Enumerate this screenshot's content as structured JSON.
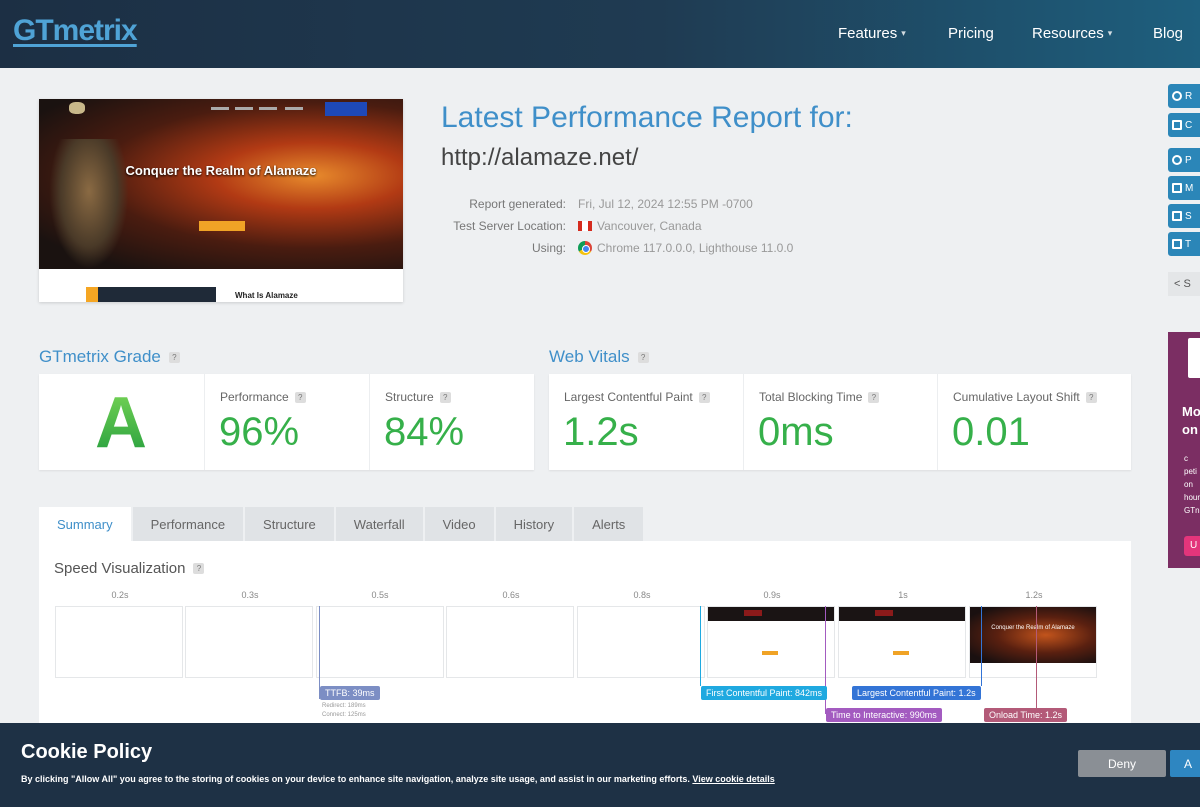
{
  "header": {
    "logo": "GTmetrix",
    "nav": [
      {
        "label": "Features",
        "dropdown": true
      },
      {
        "label": "Pricing",
        "dropdown": false
      },
      {
        "label": "Resources",
        "dropdown": true
      },
      {
        "label": "Blog",
        "dropdown": false
      }
    ]
  },
  "rail": {
    "buttons": [
      "R",
      "C",
      "P",
      "M",
      "S",
      "T"
    ],
    "share": "S",
    "promo": {
      "line1": "Mo",
      "line2": "on a",
      "body": "c\npeti\non\nhour\nGTn",
      "button": "U"
    }
  },
  "preview": {
    "hero_title": "Conquer the Realm of Alamaze",
    "section_title": "What Is Alamaze"
  },
  "report": {
    "title": "Latest Performance Report for:",
    "url": "http://alamaze.net/",
    "generated_label": "Report generated:",
    "generated_value": "Fri, Jul 12, 2024 12:55 PM -0700",
    "location_label": "Test Server Location:",
    "location_value": "Vancouver, Canada",
    "using_label": "Using:",
    "using_value": "Chrome 117.0.0.0, Lighthouse 11.0.0"
  },
  "grade": {
    "heading": "GTmetrix Grade",
    "letter": "A",
    "performance_label": "Performance",
    "performance_value": "96%",
    "structure_label": "Structure",
    "structure_value": "84%"
  },
  "vitals": {
    "heading": "Web Vitals",
    "lcp_label": "Largest Contentful Paint",
    "lcp_value": "1.2s",
    "tbt_label": "Total Blocking Time",
    "tbt_value": "0ms",
    "cls_label": "Cumulative Layout Shift",
    "cls_value": "0.01"
  },
  "tabs": [
    "Summary",
    "Performance",
    "Structure",
    "Waterfall",
    "Video",
    "History",
    "Alerts"
  ],
  "speed": {
    "heading": "Speed Visualization",
    "times": [
      "0.2s",
      "0.3s",
      "0.5s",
      "0.6s",
      "0.8s",
      "0.9s",
      "1s",
      "1.2s"
    ],
    "markers": {
      "ttfb": "TTFB: 39ms",
      "ttfb_redirect": "Redirect: 189ms",
      "ttfb_connect": "Connect: 125ms",
      "fcp": "First Contentful Paint: 842ms",
      "lcp": "Largest Contentful Paint: 1.2s",
      "tti": "Time to Interactive: 990ms",
      "onload": "Onload Time: 1.2s"
    }
  },
  "cookie": {
    "title": "Cookie Policy",
    "text": "By clicking \"Allow All\" you agree to the storing of cookies on your device to enhance site navigation, analyze site usage, and assist in our marketing efforts.",
    "link": "View cookie details",
    "deny": "Deny",
    "allow": "A"
  },
  "colors": {
    "accent": "#3f8fc9",
    "good": "#36b04a",
    "fcp": "#1fa9e0",
    "lcp": "#3374d6",
    "tti": "#a35bc0",
    "onload": "#b35a78",
    "ttfb": "#7c8ec4"
  }
}
